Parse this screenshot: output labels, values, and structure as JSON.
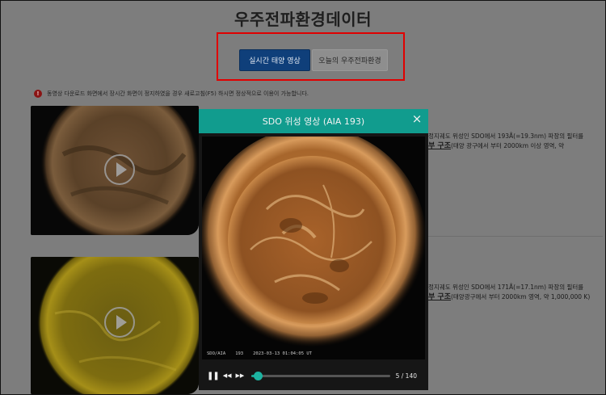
{
  "page": {
    "title": "우주전파환경데이터"
  },
  "tabs": {
    "live": "실시간 태양 영상",
    "today": "오늘의 우주전파환경"
  },
  "notice": {
    "icon": "!",
    "text": "동영상 다운로드 화면에서 장시간 화면이 정지하였을 경우 새로고침(F5) 하시면 정상적으로 이용이 가능합니다."
  },
  "items": [
    {
      "desc_line1": "정지궤도 위성인 SDO에서 193Å(=19.3nm) 파장의 필터를",
      "desc_bold": "부 구조",
      "desc_line2": "(태양 광구에서 부터 2000km 이상 영역, 약"
    },
    {
      "desc_line1": "정지궤도 위성인 SDO에서 171Å(=17.1nm) 파장의 필터를",
      "desc_bold": "부 구조",
      "desc_line2": "(태양광구에서 부터 2000km 영역, 약 1,000,000 K)"
    }
  ],
  "modal": {
    "title": "SDO 위성 영상 (AIA 193)",
    "close_icon": "×",
    "caption": {
      "instrument": "SDO/AIA",
      "wavelength": "193",
      "timestamp": "2023-03-13 01:04:05 UT"
    },
    "player": {
      "current_frame": 5,
      "total_frames": 140,
      "counter_text": "5 / 140",
      "play_icon": "❚❚",
      "rewind_icon": "◀◀",
      "forward_icon": "▶▶"
    }
  },
  "colors": {
    "header_teal": "#119c8e",
    "tab_active": "#0f3f7a",
    "highlight": "#e00000"
  }
}
